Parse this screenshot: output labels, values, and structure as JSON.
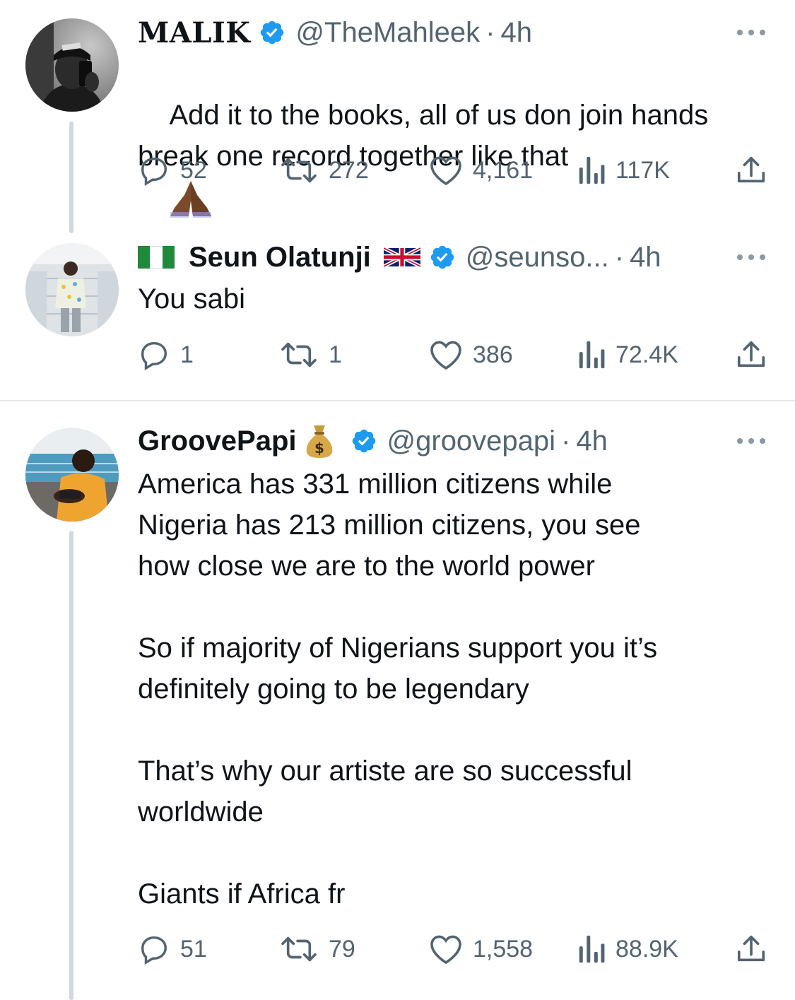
{
  "tweets": [
    {
      "name": "MALIK",
      "handle": "@TheMahleek",
      "separator": "·",
      "time": "4h",
      "text": "Add it to the books, all of us don join hands break one record together like that",
      "emoji": "folded-hands-dark-skin",
      "replies": "52",
      "retweets": "272",
      "likes": "4,161",
      "views": "117K"
    },
    {
      "name": "Seun Olatunji",
      "name_prefix_flag": "nigeria-flag",
      "name_suffix_flag": "uk-flag",
      "handle": "@seunso...",
      "separator": "·",
      "time": "4h",
      "text": "You sabi",
      "replies": "1",
      "retweets": "1",
      "likes": "386",
      "views": "72.4K"
    },
    {
      "name": "GroovePapi",
      "name_suffix_emoji": "money-bag",
      "handle": "@groovepapi",
      "separator": "·",
      "time": "4h",
      "text": "America has 331 million citizens while\nNigeria has 213 million citizens, you see\nhow close we are to the world power\n\nSo if majority of Nigerians support you it’s\ndefinitely going to be legendary\n\nThat’s why our artiste are so successful\nworldwide\n\nGiants if Africa fr",
      "replies": "51",
      "retweets": "79",
      "likes": "1,558",
      "views": "88.9K"
    }
  ],
  "colors": {
    "verified": "#1d9bf0",
    "secondary_text": "#536471",
    "primary_text": "#0f1419",
    "thread_line": "#cfd9de",
    "divider": "#e4e8eb"
  }
}
